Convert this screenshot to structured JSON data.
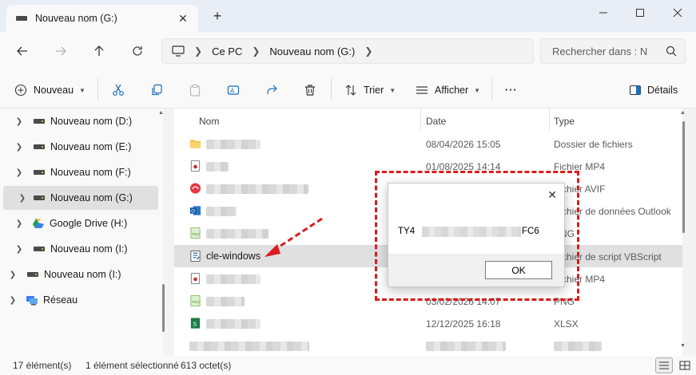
{
  "window": {
    "tab_title": "Nouveau nom (G:)",
    "close_glyph": "✕",
    "new_tab_glyph": "+"
  },
  "address": {
    "crumbs": [
      "Ce PC",
      "Nouveau nom (G:)"
    ],
    "search_placeholder": "Rechercher dans : N"
  },
  "toolbar": {
    "new_label": "Nouveau",
    "sort_label": "Trier",
    "view_label": "Afficher",
    "more_label": "···",
    "details_label": "Détails"
  },
  "sidebar": {
    "items": [
      {
        "label": "Nouveau nom (D:)",
        "icon": "drive-icon"
      },
      {
        "label": "Nouveau nom (E:)",
        "icon": "drive-icon"
      },
      {
        "label": "Nouveau nom (F:)",
        "icon": "drive-icon"
      },
      {
        "label": "Nouveau nom (G:)",
        "icon": "drive-icon",
        "selected": true
      },
      {
        "label": "Google Drive (H:)",
        "icon": "google-drive-icon"
      },
      {
        "label": "Nouveau nom (I:)",
        "icon": "drive-icon"
      },
      {
        "label": "Nouveau nom (I:)",
        "icon": "drive-icon"
      },
      {
        "label": "Réseau",
        "icon": "network-icon"
      }
    ]
  },
  "columns": {
    "name": "Nom",
    "date": "Date",
    "type": "Type"
  },
  "files": [
    {
      "name": "",
      "date": "08/04/2026 15:05",
      "type": "Dossier de fichiers",
      "icon": "folder-icon"
    },
    {
      "name": "",
      "date": "01/08/2025 14:14",
      "type": "Fichier MP4",
      "icon": "video-file-icon"
    },
    {
      "name": "",
      "date": "",
      "type": "Fichier AVIF",
      "icon": "avif-file-icon"
    },
    {
      "name": "",
      "date": "",
      "type": "Fichier de données Outlook",
      "icon": "outlook-file-icon"
    },
    {
      "name": "",
      "date": "",
      "type": "PNG",
      "icon": "png-file-icon"
    },
    {
      "name": "cle-windows",
      "date": "",
      "type": "Fichier de script VBScript",
      "icon": "vbscript-file-icon",
      "selected": true
    },
    {
      "name": "",
      "date": "",
      "type": "Fichier MP4",
      "icon": "video-file-icon"
    },
    {
      "name": "",
      "date": "03/02/2026 14:07",
      "type": "PNG",
      "icon": "png-file-icon"
    },
    {
      "name": "",
      "date": "12/12/2025 16:18",
      "type": "XLSX",
      "icon": "excel-file-icon"
    }
  ],
  "dialog": {
    "message_start": "TY4",
    "message_end": "FC6",
    "ok_label": "OK",
    "close_glyph": "✕"
  },
  "status": {
    "count": "17 élément(s)",
    "selection": "1 élément sélectionné",
    "size": "613 octet(s)"
  },
  "colors": {
    "annotation": "#d91d1d",
    "selection": "#e0e0e0",
    "folder": "#f4c046"
  }
}
